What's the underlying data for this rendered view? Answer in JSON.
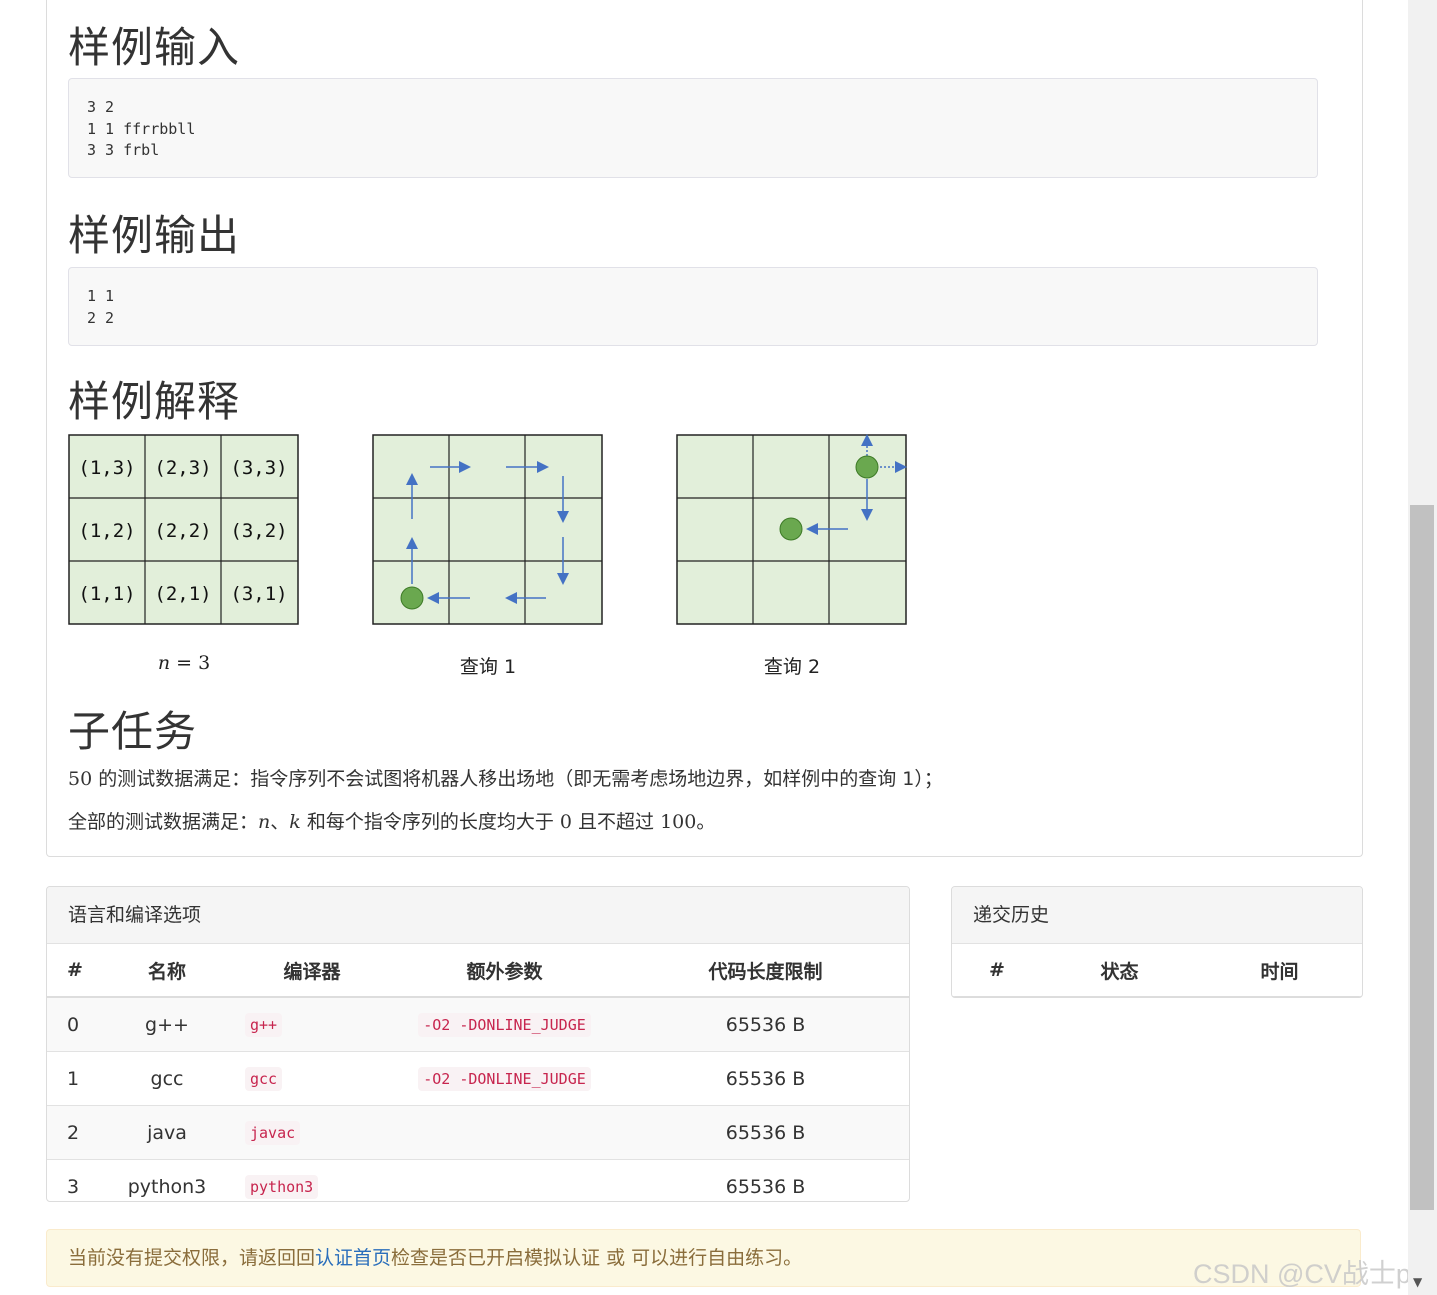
{
  "sections": {
    "sample_input_title": "样例输入",
    "sample_input_lines": [
      "3 2",
      "1 1 ffrrbbll",
      "3 3 frbl"
    ],
    "sample_output_title": "样例输出",
    "sample_output_lines": [
      "1 1",
      "2 2"
    ],
    "sample_explain_title": "样例解释",
    "subtask_title": "子任务"
  },
  "figures": {
    "grid_labels": [
      [
        "(1,3)",
        "(2,3)",
        "(3,3)"
      ],
      [
        "(1,2)",
        "(2,2)",
        "(3,2)"
      ],
      [
        "(1,1)",
        "(2,1)",
        "(3,1)"
      ]
    ],
    "caption1_var": "n",
    "caption1_rest": " = 3",
    "caption2": "查询 1",
    "caption3": "查询 2",
    "cell_color": "#e2efda",
    "dot_color": "#6aa84f",
    "arrow_color": "#4472c4"
  },
  "subtask": {
    "line1_num": "50",
    "line1_text": " 的测试数据满足：指令序列不会试图将机器人移出场地（即无需考虑场地边界，如样例中的查询 1）；",
    "line2_prefix": "全部的测试数据满足：",
    "line2_var1": "n",
    "line2_sep": "、",
    "line2_var2": "k",
    "line2_mid": " 和每个指令序列的长度均大于 ",
    "line2_zero": "0",
    "line2_mid2": " 且不超过 ",
    "line2_hundred": "100",
    "line2_end": "。"
  },
  "lang_panel": {
    "title": "语言和编译选项",
    "headers": [
      "#",
      "名称",
      "编译器",
      "额外参数",
      "代码长度限制"
    ],
    "rows": [
      {
        "idx": "0",
        "name": "g++",
        "compiler": "g++",
        "args": "-O2 -DONLINE_JUDGE",
        "limit": "65536 B"
      },
      {
        "idx": "1",
        "name": "gcc",
        "compiler": "gcc",
        "args": "-O2 -DONLINE_JUDGE",
        "limit": "65536 B"
      },
      {
        "idx": "2",
        "name": "java",
        "compiler": "javac",
        "args": "",
        "limit": "65536 B"
      },
      {
        "idx": "3",
        "name": "python3",
        "compiler": "python3",
        "args": "",
        "limit": "65536 B"
      }
    ]
  },
  "history_panel": {
    "title": "递交历史",
    "headers": [
      "#",
      "状态",
      "时间"
    ]
  },
  "alert": {
    "before": "当前没有提交权限，请返回回",
    "link": "认证首页",
    "after": "检查是否已开启模拟认证 或 可以进行自由练习。"
  },
  "watermark": "CSDN @CV战士plus"
}
